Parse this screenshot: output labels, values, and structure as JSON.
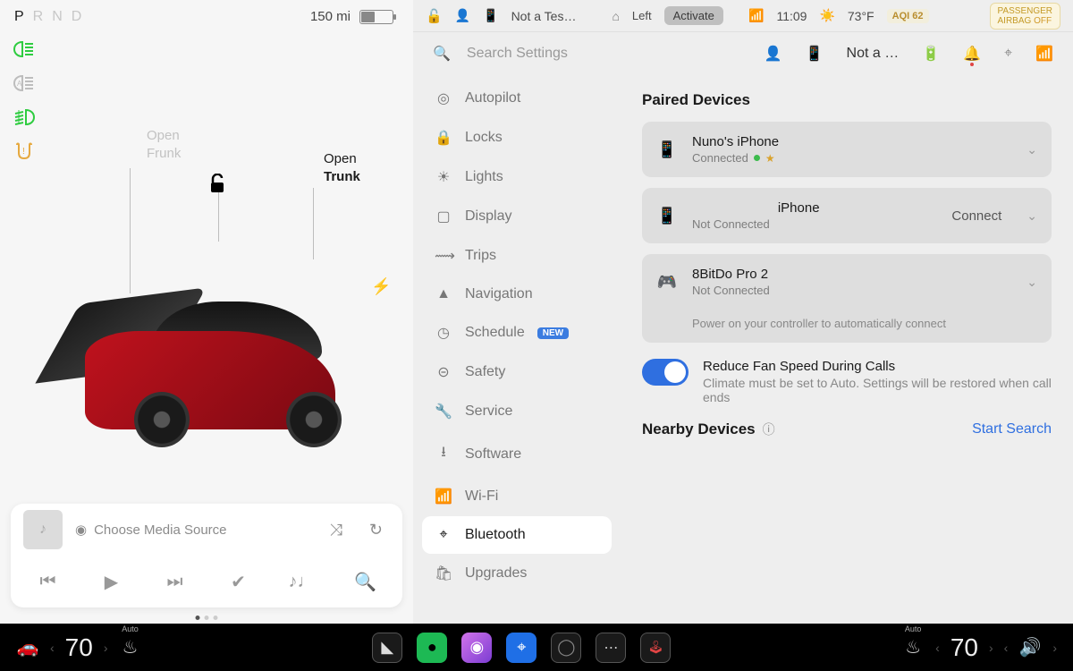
{
  "gear": {
    "p": "P",
    "r": "R",
    "n": "N",
    "d": "D"
  },
  "range": "150 mi",
  "callouts": {
    "frunk1": "Open",
    "frunk2": "Frunk",
    "trunk1": "Open",
    "trunk2": "Trunk"
  },
  "media": {
    "source": "Choose Media Source"
  },
  "status": {
    "profile": "Not a Tes…",
    "homelink": "Left",
    "activate": "Activate",
    "time": "11:09",
    "temp": "73°F",
    "aqi_label": "AQI",
    "aqi_val": "62",
    "airbag1": "PASSENGER",
    "airbag2": "AIRBAG",
    "airbag_off": "OFF"
  },
  "settings": {
    "search_ph": "Search Settings",
    "profile_short": "Not a …",
    "nav": {
      "autopilot": "Autopilot",
      "locks": "Locks",
      "lights": "Lights",
      "display": "Display",
      "trips": "Trips",
      "navigation": "Navigation",
      "schedule": "Schedule",
      "schedule_badge": "NEW",
      "safety": "Safety",
      "service": "Service",
      "software": "Software",
      "wifi": "Wi-Fi",
      "bluetooth": "Bluetooth",
      "upgrades": "Upgrades"
    },
    "paired_title": "Paired Devices",
    "devices": [
      {
        "name": "Nuno's iPhone",
        "status": "Connected"
      },
      {
        "name": "iPhone",
        "status": "Not Connected",
        "action": "Connect"
      },
      {
        "name": "8BitDo Pro 2",
        "status": "Not Connected",
        "hint": "Power on your controller to automatically connect"
      }
    ],
    "fan_title": "Reduce Fan Speed During Calls",
    "fan_desc": "Climate must be set to Auto. Settings will be restored when call ends",
    "nearby": "Nearby Devices",
    "start_search": "Start Search"
  },
  "bottom": {
    "temp_left": "70",
    "temp_right": "70",
    "auto": "Auto"
  }
}
